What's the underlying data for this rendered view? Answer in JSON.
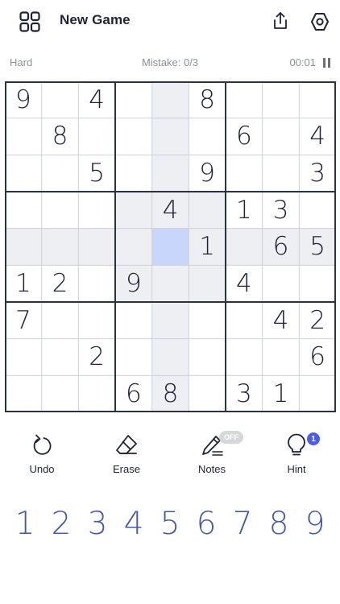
{
  "header": {
    "title": "New Game",
    "icons": [
      "grid-menu-icon",
      "share-icon",
      "settings-icon"
    ]
  },
  "status": {
    "difficulty": "Hard",
    "mistakes": "Mistake: 0/3",
    "timer": "00:01"
  },
  "board": {
    "selected": [
      4,
      4
    ],
    "cells": [
      [
        "9",
        "",
        "4",
        "",
        "",
        "8",
        "",
        "",
        ""
      ],
      [
        "",
        "8",
        "",
        "",
        "",
        "",
        "6",
        "",
        "4"
      ],
      [
        "",
        "",
        "5",
        "",
        "",
        "9",
        "",
        "",
        "3"
      ],
      [
        "",
        "",
        "",
        "",
        "4",
        "",
        "1",
        "3",
        ""
      ],
      [
        "",
        "",
        "",
        "",
        "",
        "1",
        "",
        "6",
        "5"
      ],
      [
        "1",
        "2",
        "",
        "9",
        "",
        "",
        "4",
        "",
        ""
      ],
      [
        "7",
        "",
        "",
        "",
        "",
        "",
        "",
        "4",
        "2"
      ],
      [
        "",
        "",
        "2",
        "",
        "",
        "",
        "",
        "",
        "6"
      ],
      [
        "",
        "",
        "",
        "6",
        "8",
        "",
        "3",
        "1",
        ""
      ]
    ]
  },
  "tools": {
    "undo": "Undo",
    "erase": "Erase",
    "notes": "Notes",
    "notes_state": "OFF",
    "hint": "Hint",
    "hint_count": "1"
  },
  "numpad": [
    "1",
    "2",
    "3",
    "4",
    "5",
    "6",
    "7",
    "8",
    "9"
  ],
  "colors": {
    "accent": "#485aa0",
    "selected_cell": "#c9d6fb",
    "related_cell": "#edeff3",
    "badge": "#4a5fe0"
  }
}
